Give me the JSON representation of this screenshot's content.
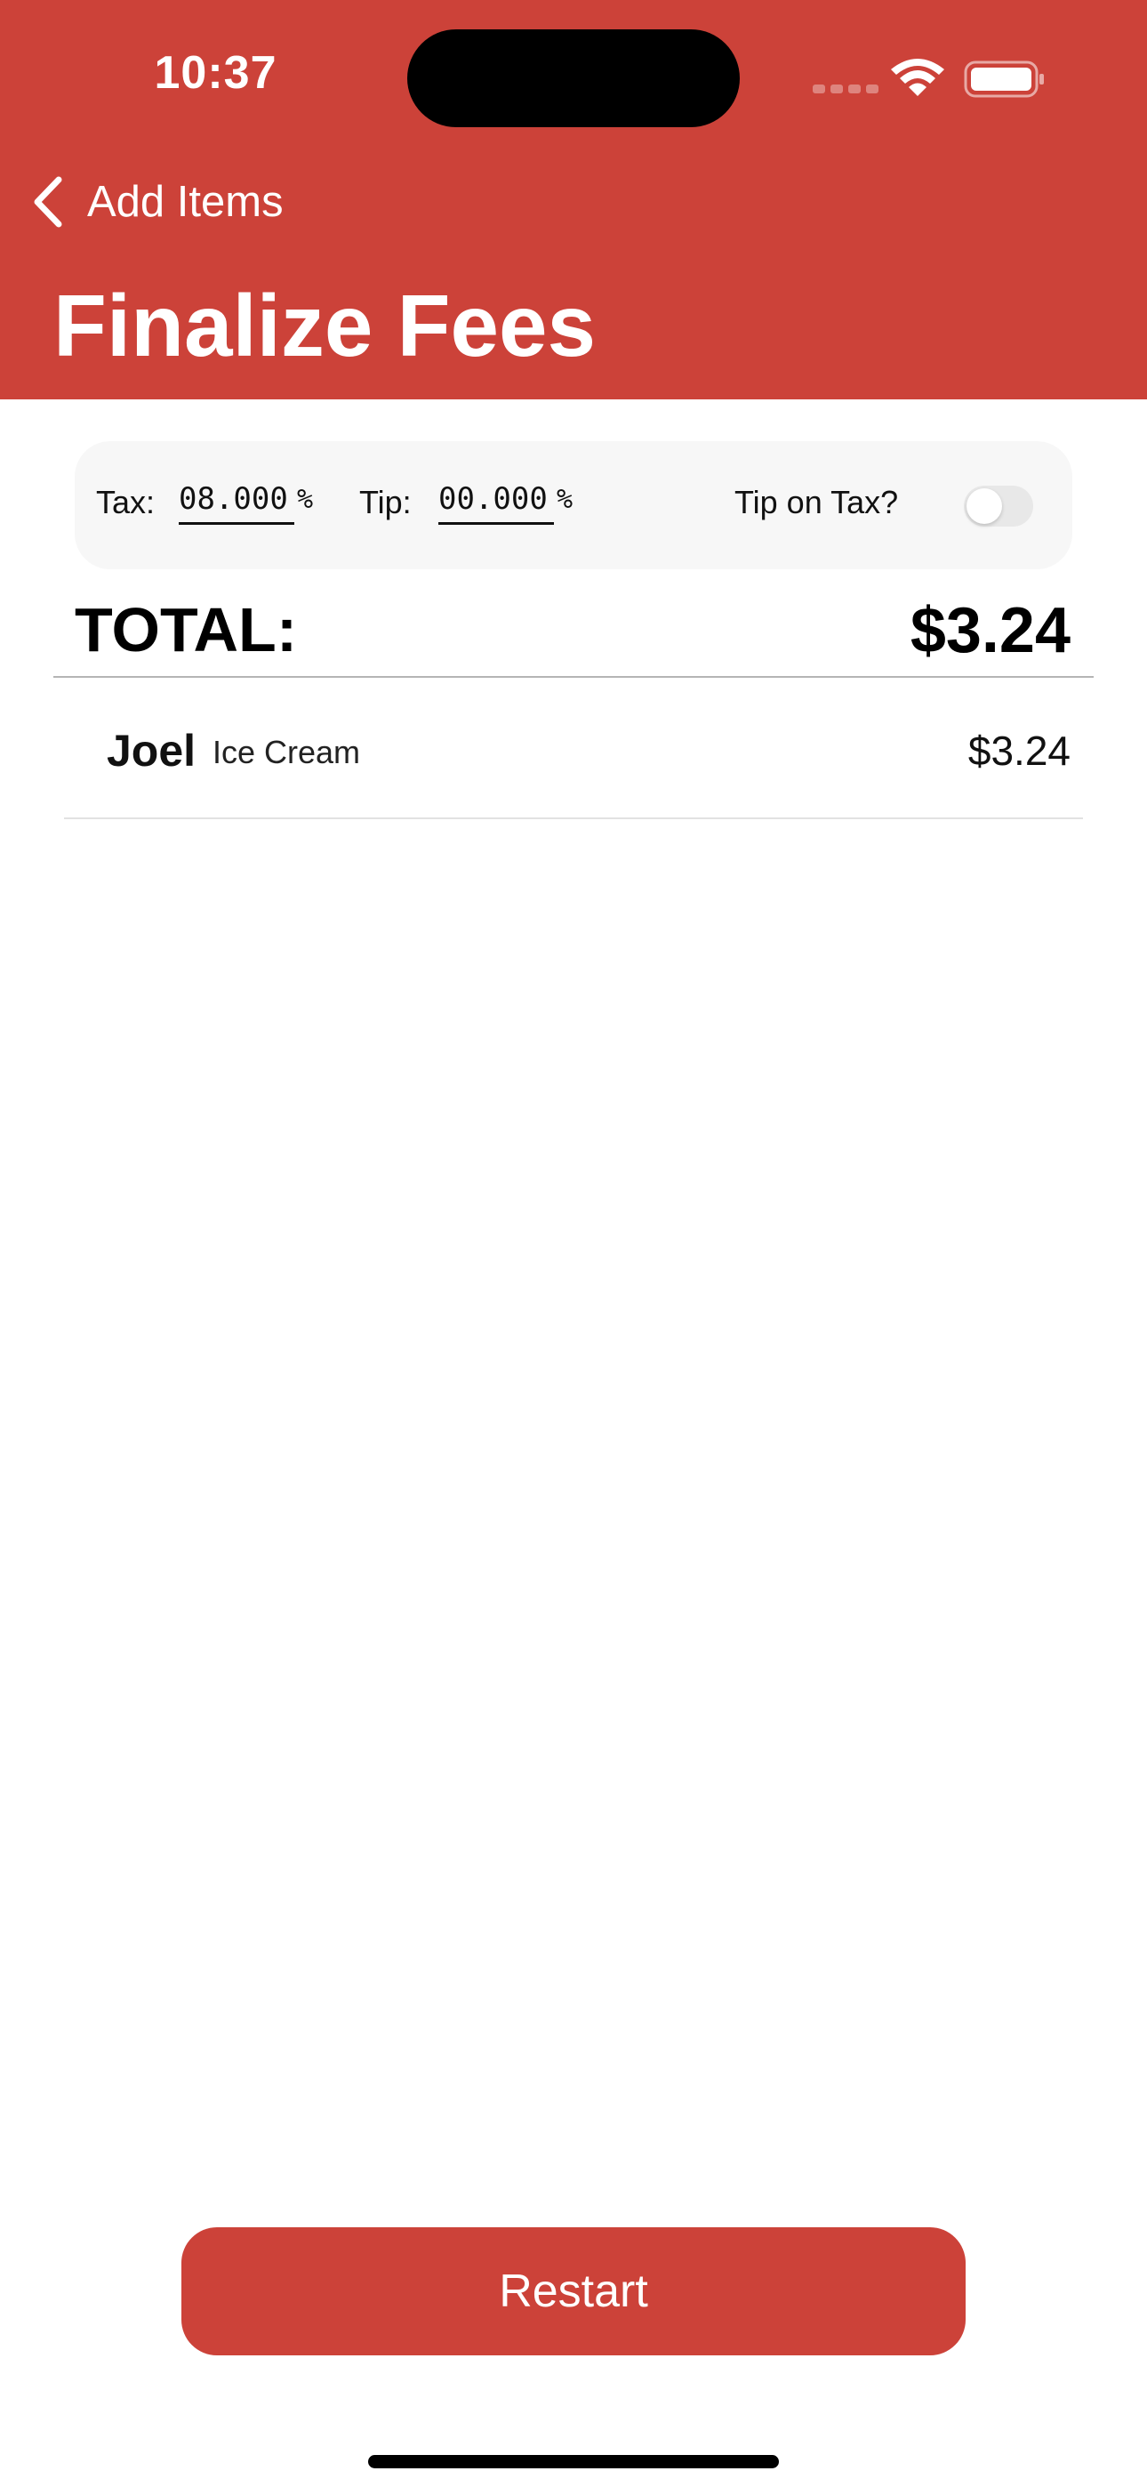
{
  "status_bar": {
    "time": "10:37"
  },
  "nav": {
    "back_label": "Add Items",
    "title": "Finalize Fees"
  },
  "fees": {
    "tax_label": "Tax:",
    "tax_value": "08.000",
    "tip_label": "Tip:",
    "tip_value": "00.000",
    "percent_symbol": "%",
    "tip_on_tax_label": "Tip on Tax?",
    "tip_on_tax_enabled": false
  },
  "summary": {
    "total_label": "TOTAL:",
    "total_value": "$3.24"
  },
  "items": [
    {
      "person": "Joel",
      "item": "Ice Cream",
      "amount": "$3.24"
    }
  ],
  "actions": {
    "restart_label": "Restart"
  },
  "colors": {
    "brand": "#cc4239"
  }
}
